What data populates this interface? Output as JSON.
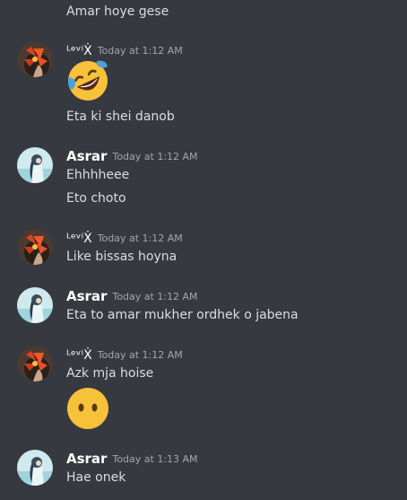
{
  "messages": {
    "top_line": "Amar hoye gese",
    "g1": {
      "username": "ᴸᵉᵛⁱẊ",
      "timestamp": "Today at 1:12 AM",
      "line1": "Eta ki shei danob"
    },
    "g2": {
      "username": "Asrar",
      "timestamp": "Today at 1:12 AM",
      "line1": "Ehhhheee",
      "line2": "Eto choto"
    },
    "g3": {
      "username": "ᴸᵉᵛⁱẊ",
      "timestamp": "Today at 1:12 AM",
      "line1": "Like bissas hoyna"
    },
    "g4": {
      "username": "Asrar",
      "timestamp": "Today at 1:12 AM",
      "line1": "Eta to amar mukher ordhek o jabena"
    },
    "g5": {
      "username": "ᴸᵉᵛⁱẊ",
      "timestamp": "Today at 1:12 AM",
      "line1": "Azk mja hoise"
    },
    "g6": {
      "username": "Asrar",
      "timestamp": "Today at 1:13 AM",
      "line1": "Hae onek"
    }
  },
  "icons": {
    "laughing_emoji": "rolling-on-floor-laughing-emoji",
    "no_mouth_emoji": "face-without-mouth-emoji"
  },
  "colors": {
    "background": "#36393f",
    "text": "#dcddde",
    "username": "#ffffff",
    "timestamp": "#a3a6aa"
  }
}
